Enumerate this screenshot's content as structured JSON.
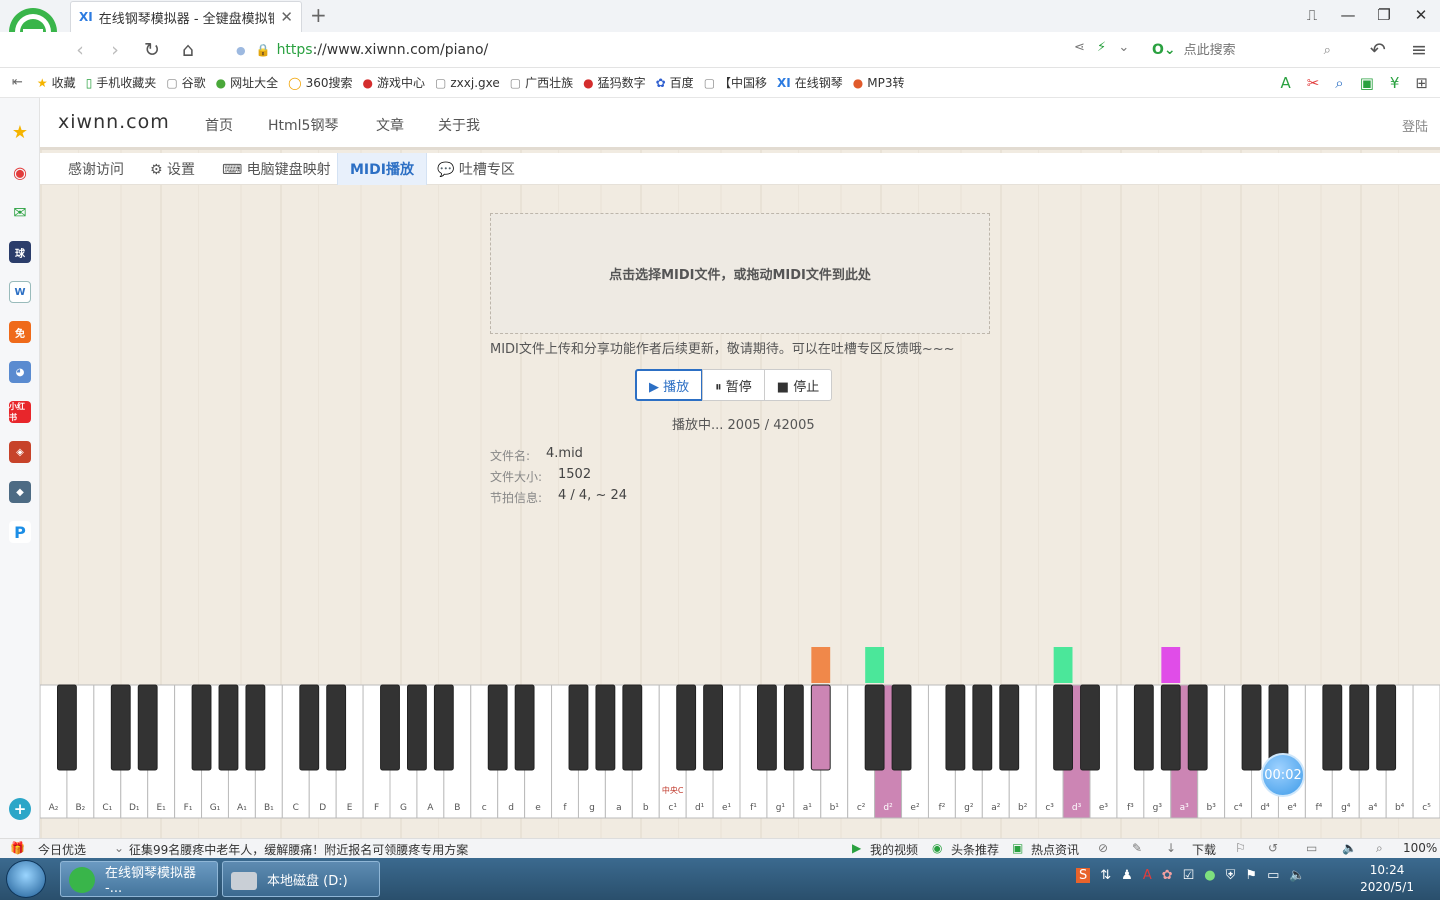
{
  "browser": {
    "tab_title": "在线钢琴模拟器 - 全键盘模拟钢琴",
    "tab_favicon": "XI",
    "url_scheme": "https",
    "url_rest": "://www.xiwnn.com/piano/",
    "search_placeholder": "点此搜索",
    "bookmarks": [
      {
        "label": "收藏",
        "icon": "★"
      },
      {
        "label": "手机收藏夹",
        "icon": "▯"
      },
      {
        "label": "谷歌",
        "icon": "▢"
      },
      {
        "label": "网址大全",
        "icon": "●"
      },
      {
        "label": "360搜索",
        "icon": "◯"
      },
      {
        "label": "游戏中心",
        "icon": "●"
      },
      {
        "label": "zxxj.gxe",
        "icon": "▢"
      },
      {
        "label": "广西壮族",
        "icon": "▢"
      },
      {
        "label": "猛犸数字",
        "icon": "●"
      },
      {
        "label": "百度",
        "icon": "✿"
      },
      {
        "label": "【中国移",
        "icon": "▢"
      },
      {
        "label": "在线钢琴",
        "icon": "XI"
      },
      {
        "label": "MP3转",
        "icon": "●"
      }
    ]
  },
  "site": {
    "logo": "xiwnn.com",
    "nav": [
      "首页",
      "Html5钢琴",
      "文章",
      "关于我"
    ],
    "login": "登陆",
    "subnav": [
      {
        "label": "感谢访问"
      },
      {
        "label": "⚙ 设置"
      },
      {
        "label": "⌨ 电脑键盘映射"
      },
      {
        "label": "MIDI播放"
      },
      {
        "label": "💬 吐槽专区"
      }
    ]
  },
  "midi": {
    "drop_text": "点击选择MIDI文件，或拖动MIDI文件到此处",
    "notice": "MIDI文件上传和分享功能作者后续更新，敬请期待。可以在吐槽专区反馈哦~~~",
    "play_label": "▶ 播放",
    "pause_label": "⏸ 暂停",
    "stop_label": "■ 停止",
    "status": "播放中... 2005 / 42005",
    "file_name_label": "文件名:",
    "file_name": "4.mid",
    "file_size_label": "文件大小:",
    "file_size": "1502",
    "beat_label": "节拍信息:",
    "beat": "4 / 4, ~ 24"
  },
  "piano": {
    "white_keys": [
      "A₂",
      "B₂",
      "C₁",
      "D₁",
      "E₁",
      "F₁",
      "G₁",
      "A₁",
      "B₁",
      "C",
      "D",
      "E",
      "F",
      "G",
      "A",
      "B",
      "c",
      "d",
      "e",
      "f",
      "g",
      "a",
      "b",
      "c¹",
      "d¹",
      "e¹",
      "f¹",
      "g¹",
      "a¹",
      "b¹",
      "c²",
      "d²",
      "e²",
      "f²",
      "g²",
      "a²",
      "b²",
      "c³",
      "d³",
      "e³",
      "f³",
      "g³",
      "a³",
      "b³",
      "c⁴",
      "d⁴",
      "e⁴",
      "f⁴",
      "g⁴",
      "a⁴",
      "b⁴",
      "c⁵"
    ],
    "middle_c_label": "中央C",
    "pressed_white": [
      "d²",
      "d³",
      "a³"
    ],
    "pressed_black": [
      "a#¹"
    ],
    "falling_notes": [
      {
        "key": "a#¹",
        "color": "#f0884a"
      },
      {
        "key": "c#²",
        "color": "#4be79a"
      },
      {
        "key": "c#³",
        "color": "#4be79a"
      },
      {
        "key": "g#³",
        "color": "#e04de8"
      }
    ],
    "pressed_color": "#cc85b4",
    "timer": "00:02"
  },
  "statusbar": {
    "left": "今日优选",
    "news": "征集99名腰疼中老年人，缓解腰痛！附近报名可领腰疼专用方案",
    "my_video": "我的视频",
    "headline": "头条推荐",
    "hot": "热点资讯",
    "download": "下载",
    "zoom": "100%"
  },
  "taskbar": {
    "items": [
      "在线钢琴模拟器 -...",
      "本地磁盘 (D:)"
    ],
    "time": "10:24",
    "date": "2020/5/1"
  }
}
